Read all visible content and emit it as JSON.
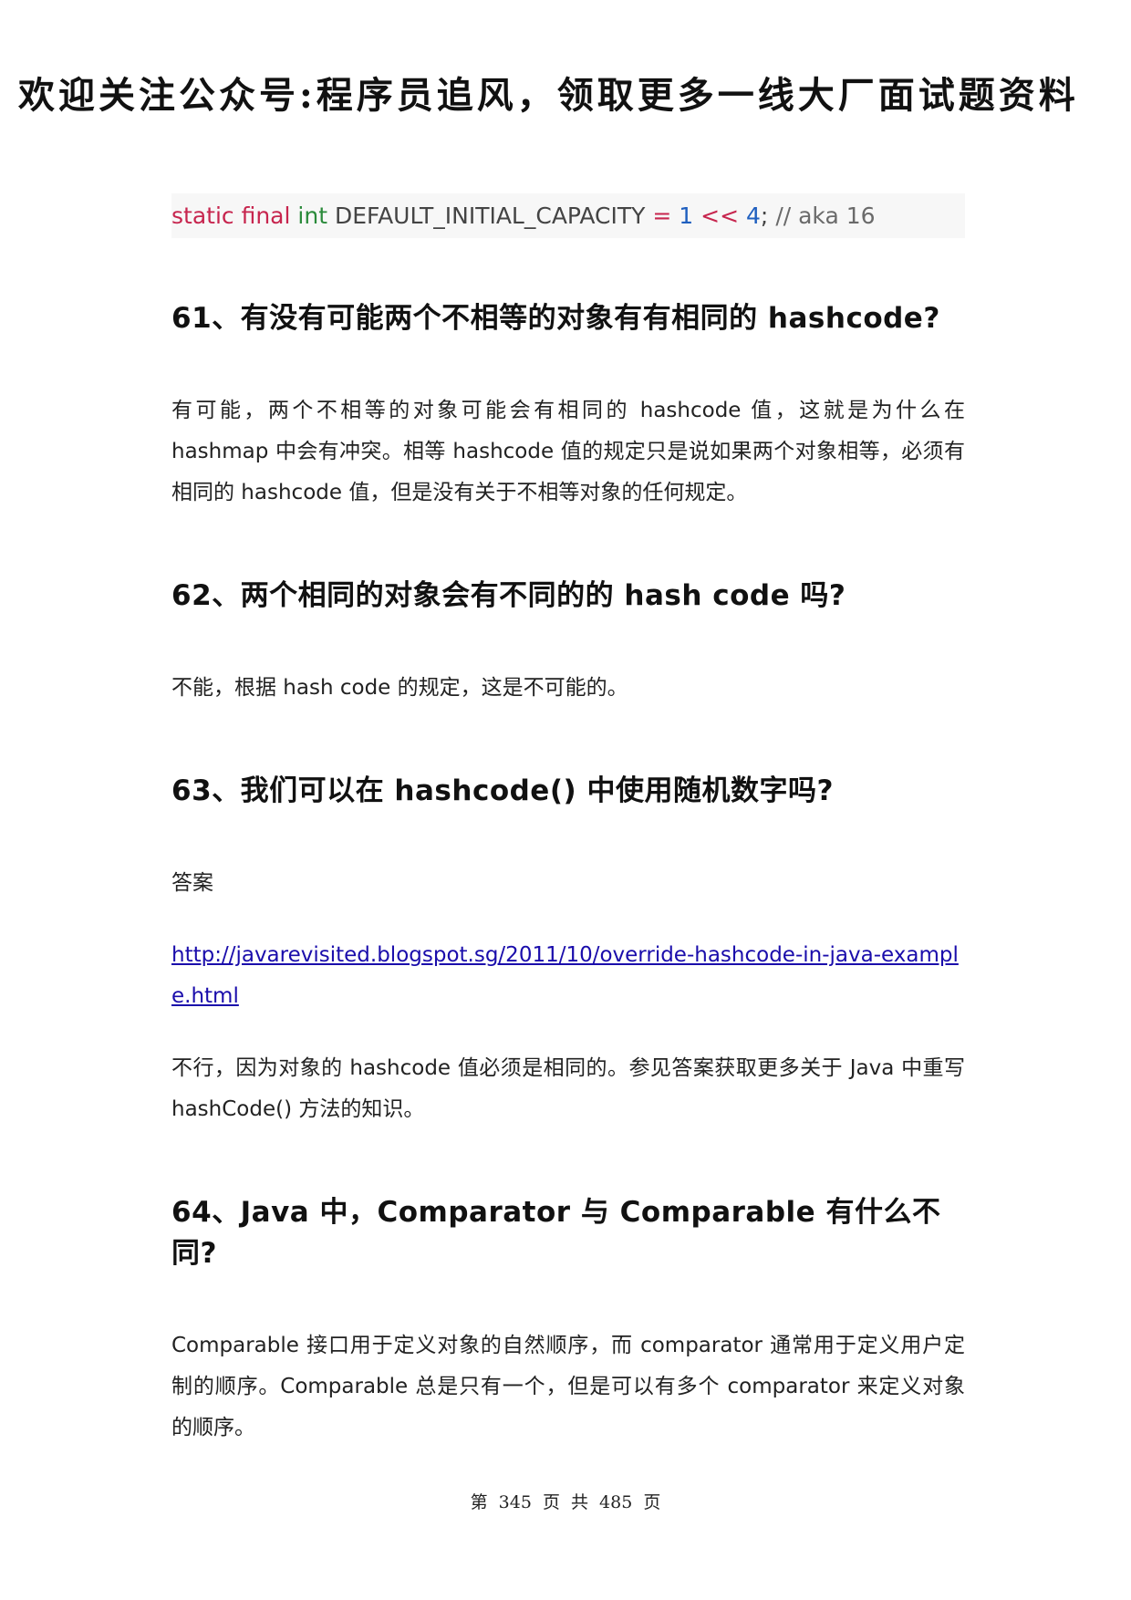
{
  "banner": "欢迎关注公众号:程序员追风，领取更多一线大厂面试题资料",
  "code": {
    "static": "static",
    "final": "final",
    "int": "int",
    "name": "DEFAULT_INITIAL_CAPACITY",
    "eq": "=",
    "one": "1",
    "shift": "<<",
    "four": "4",
    "semi": ";",
    "comment": "// aka 16"
  },
  "sections": [
    {
      "heading": "61、有没有可能两个不相等的对象有有相同的 hashcode?",
      "paragraphs": [
        "有可能，两个不相等的对象可能会有相同的 hashcode 值，这就是为什么在 hashmap 中会有冲突。相等 hashcode 值的规定只是说如果两个对象相等，必须有相同的 hashcode 值，但是没有关于不相等对象的任何规定。"
      ]
    },
    {
      "heading": "62、两个相同的对象会有不同的的 hash code 吗?",
      "paragraphs": [
        "不能，根据 hash code 的规定，这是不可能的。"
      ]
    },
    {
      "heading": "63、我们可以在 hashcode() 中使用随机数字吗?",
      "answer_label": "答案",
      "link": "http://javarevisited.blogspot.sg/2011/10/override-hashcode-in-java-example.html",
      "paragraphs": [
        "不行，因为对象的 hashcode 值必须是相同的。参见答案获取更多关于 Java 中重写 hashCode() 方法的知识。"
      ]
    },
    {
      "heading": "64、Java 中，Comparator 与 Comparable 有什么不同?",
      "paragraphs": [
        "Comparable 接口用于定义对象的自然顺序，而 comparator 通常用于定义用户定制的顺序。Comparable 总是只有一个，但是可以有多个 comparator 来定义对象的顺序。"
      ]
    }
  ],
  "footer": "第 345 页 共 485 页"
}
